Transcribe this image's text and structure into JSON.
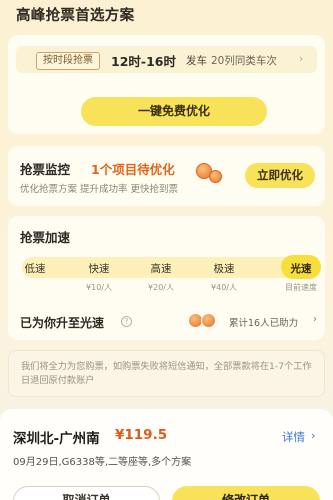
{
  "header": {
    "title": "高峰抢票首选方案"
  },
  "plan": {
    "badge": "按时段抢票",
    "time": "12时-16时",
    "car_label": "发车",
    "cars": "20列同类车次",
    "optimize_button": "一键免费优化"
  },
  "monitor": {
    "title": "抢票监控",
    "count_text": "1个项目待优化",
    "subtitle": "优化抢票方案 提升成功率 更快抢到票",
    "button": "立即优化"
  },
  "speed": {
    "title": "抢票加速",
    "levels": [
      {
        "label": "低速",
        "price": ""
      },
      {
        "label": "快速",
        "price": "¥10/人"
      },
      {
        "label": "高速",
        "price": "¥20/人"
      },
      {
        "label": "极速",
        "price": "¥40/人"
      },
      {
        "label": "光速",
        "price": "目前速度"
      }
    ],
    "active_index": 4,
    "upgrade_text": "已为你升至光速",
    "helped_text": "累计16人已助力"
  },
  "notice": {
    "text": "我们将全力为您购票，如购票失败将短信通知，全部票款将在1-7个工作日退回原付款账户"
  },
  "trip": {
    "route": "深圳北-广州南",
    "price": "¥119.5",
    "detail_link": "详情",
    "info": "09月29日,G6338等,二等座等,多个方案",
    "cancel_button": "取消订单",
    "modify_button": "修改订单"
  },
  "colors": {
    "accent_yellow": "#f8e25a",
    "highlight_orange": "#e1661d",
    "price_red": "#e05a1b",
    "link_blue": "#3a7ad6"
  }
}
